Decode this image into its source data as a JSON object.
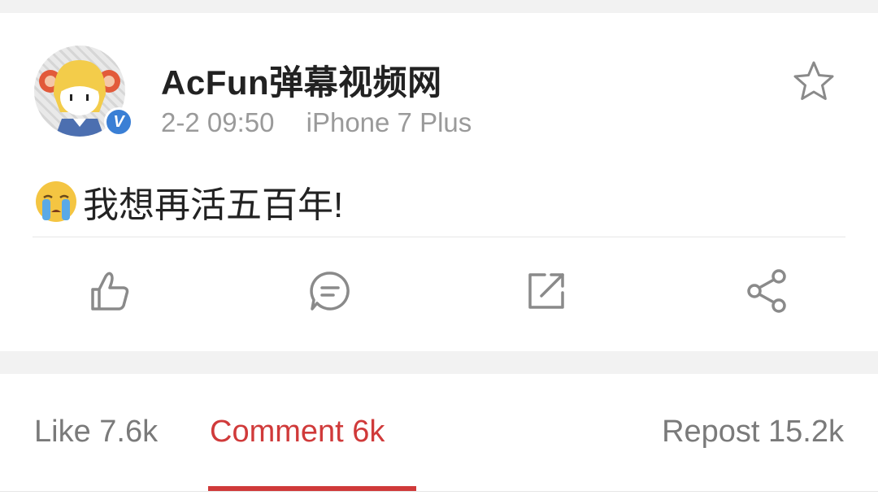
{
  "post": {
    "author": "AcFun弹幕视频网",
    "time": "2-2 09:50",
    "device": "iPhone 7 Plus",
    "verified_mark": "V",
    "text": "我想再活五百年!",
    "emoji": "crying-face"
  },
  "actions": {
    "items": [
      "like-icon",
      "comment-icon",
      "repost-icon",
      "share-icon"
    ],
    "favorite": "star-icon"
  },
  "tabs": {
    "like": "Like 7.6k",
    "comment": "Comment 6k",
    "repost": "Repost 15.2k",
    "active": "comment"
  },
  "colors": {
    "accent": "#d03a3a",
    "verified": "#3a7fd5",
    "muted_text": "#9a9a9a"
  }
}
